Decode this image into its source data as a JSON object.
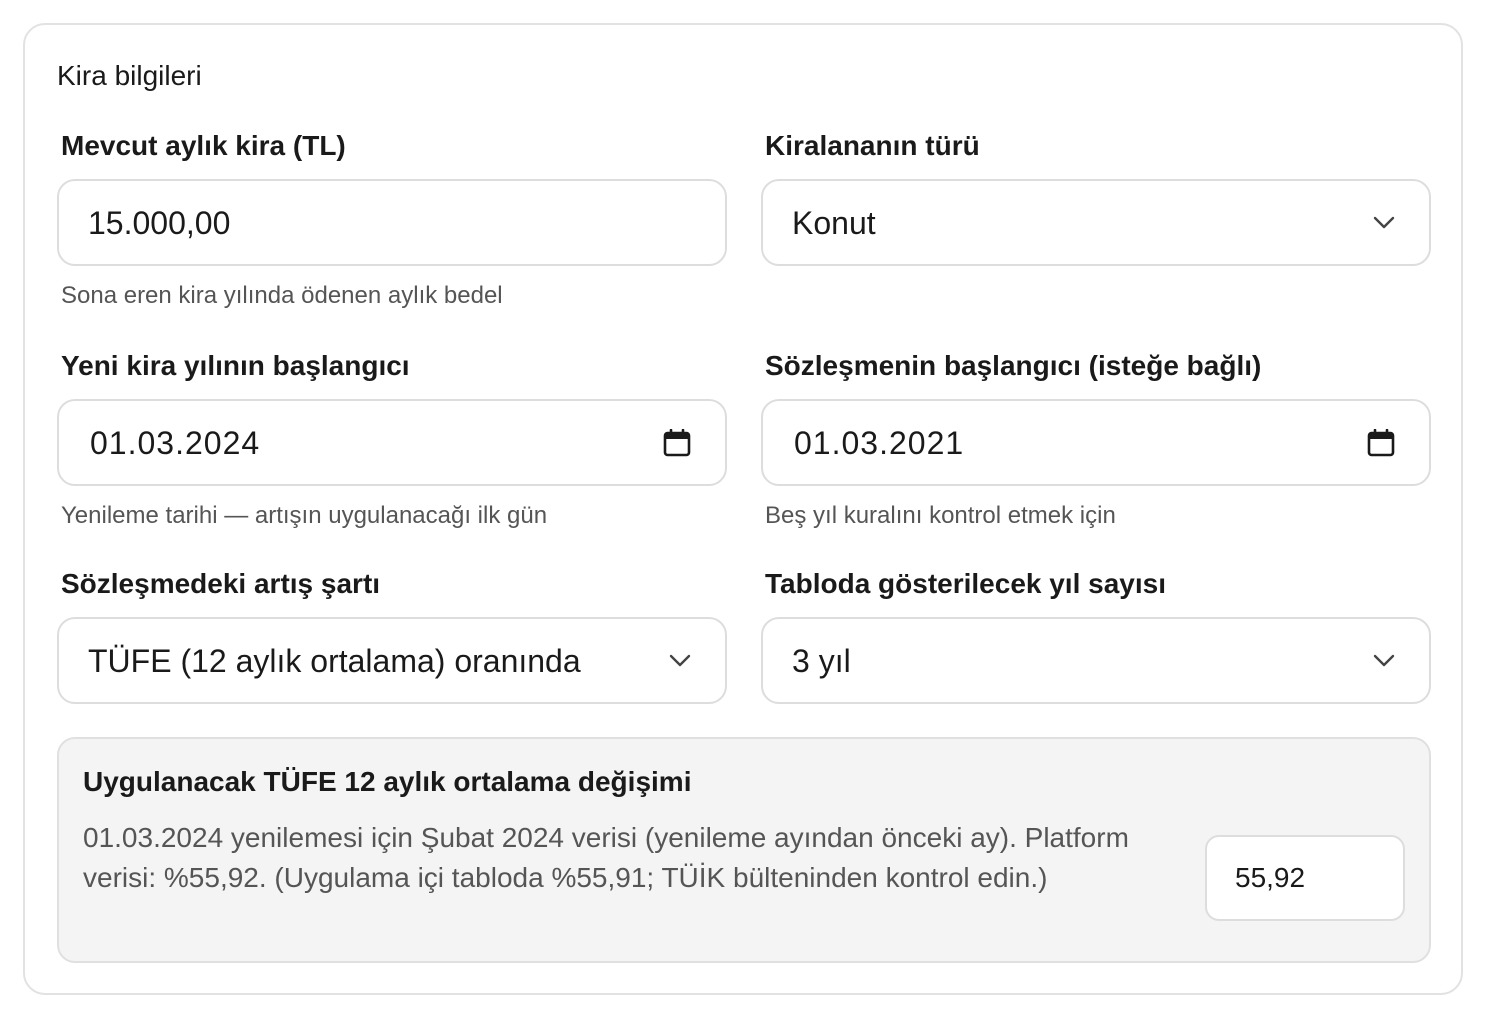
{
  "section": {
    "title": "Kira bilgileri"
  },
  "current_rent": {
    "label": "Mevcut aylık kira (TL)",
    "value": "15.000,00",
    "hint": "Sona eren kira yılında ödenen aylık bedel"
  },
  "property_type": {
    "label": "Kiralananın türü",
    "selected": "Konut",
    "icon": "chevron-down-icon"
  },
  "new_year_start": {
    "label": "Yeni kira yılının başlangıcı",
    "value": "01.03.2024",
    "hint": "Yenileme tarihi — artışın uygulanacağı ilk gün",
    "icon": "calendar-icon"
  },
  "contract_start": {
    "label": "Sözleşmenin başlangıcı (isteğe bağlı)",
    "value": "01.03.2021",
    "hint": "Beş yıl kuralını kontrol etmek için",
    "icon": "calendar-icon"
  },
  "increase_term": {
    "label": "Sözleşmedeki artış şartı",
    "selected": "TÜFE (12 aylık ortalama) oranında",
    "icon": "chevron-down-icon"
  },
  "years_shown": {
    "label": "Tabloda gösterilecek yıl sayısı",
    "selected": "3 yıl",
    "icon": "chevron-down-icon"
  },
  "cpi_info": {
    "title": "Uygulanacak TÜFE 12 aylık ortalama değişimi",
    "text": "01.03.2024 yenilemesi için Şubat 2024 verisi (yenileme ayından önceki ay). Platform verisi: %55,92. (Uygulama içi tabloda %55,91; TÜİK bülteninden kontrol edin.)",
    "rate_value": "55,92"
  },
  "colors": {
    "border": "#dddddd",
    "hint_text": "#555555",
    "info_bg": "#f4f4f4"
  }
}
